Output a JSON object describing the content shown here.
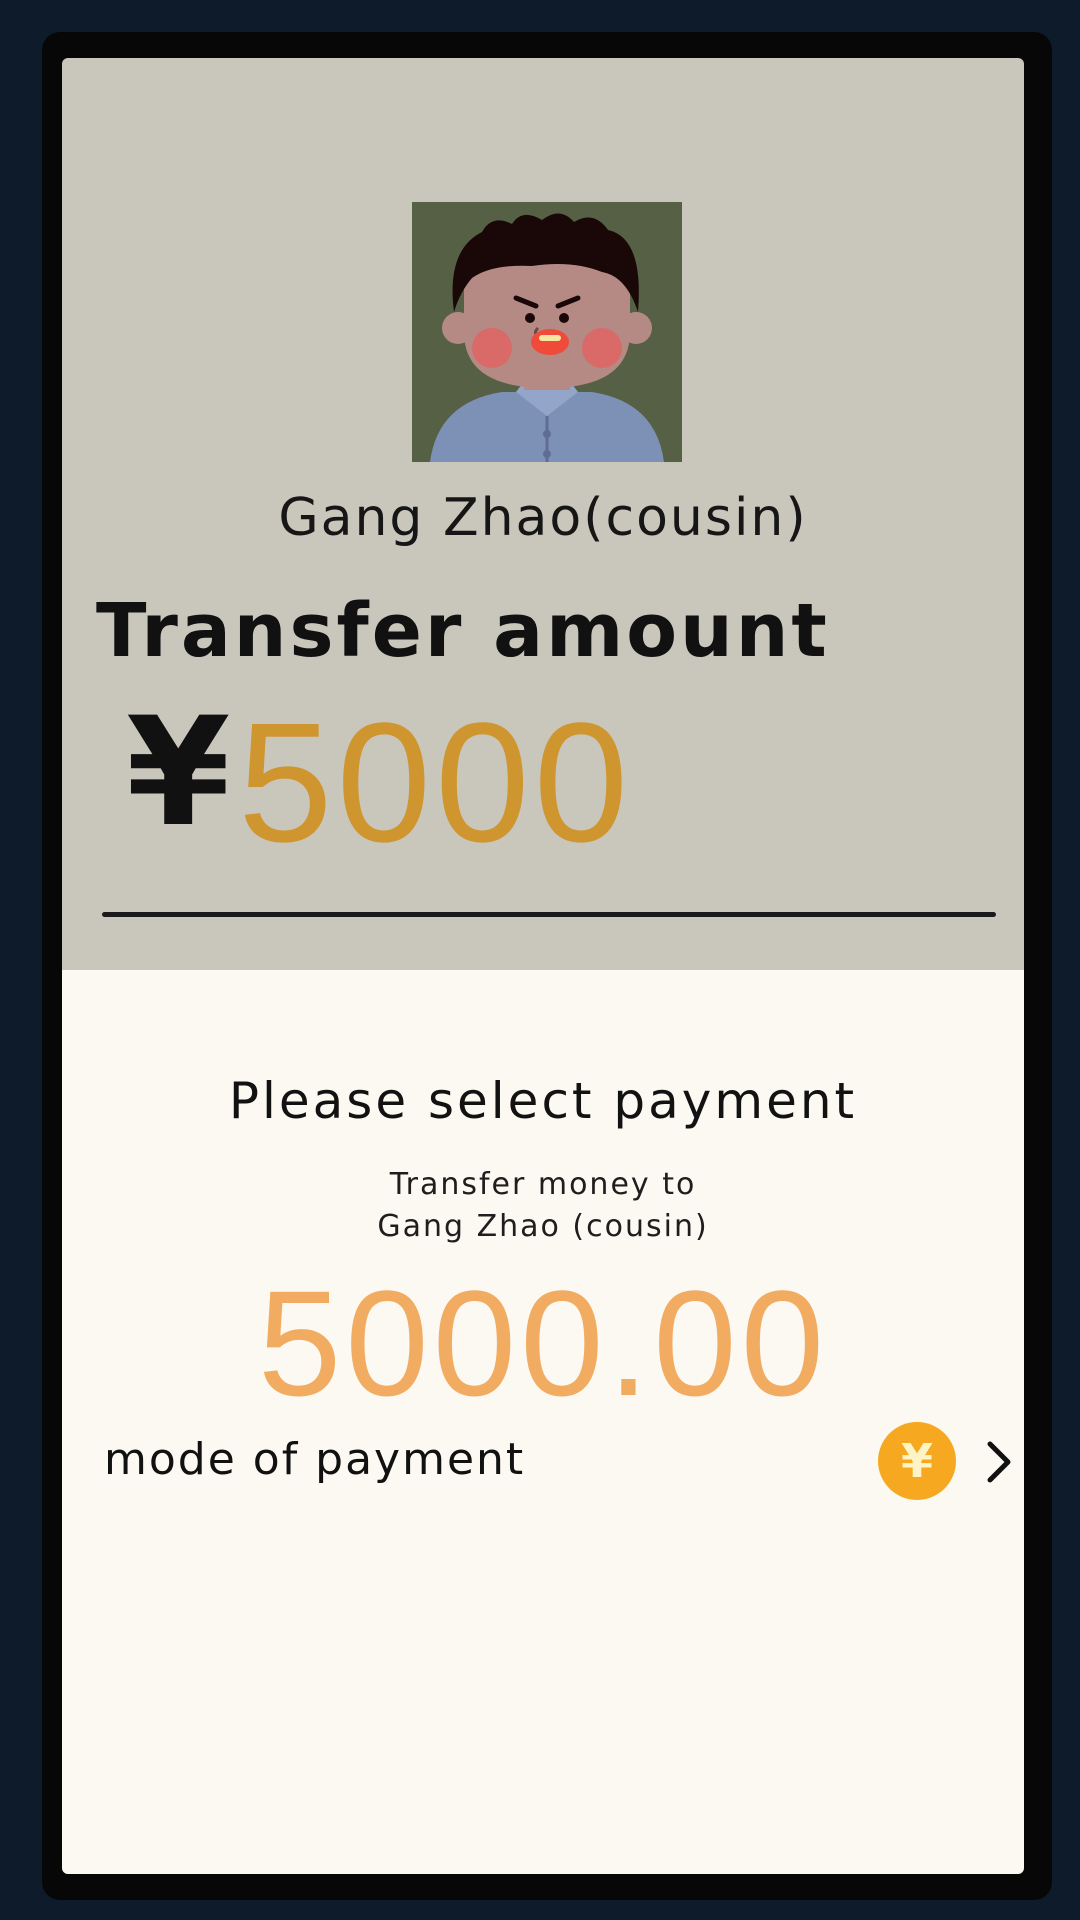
{
  "contact": {
    "name": "Gang Zhao(cousin)"
  },
  "transfer": {
    "label": "Transfer amount",
    "currency_symbol": "¥",
    "amount": "5000"
  },
  "payment_sheet": {
    "title": "Please select payment",
    "transfer_to_line1": "Transfer money to",
    "transfer_to_line2": "Gang Zhao (cousin)",
    "amount": "5000.00",
    "mode_label": "mode of payment",
    "mode_icon": "yuan-coin-icon",
    "coin_symbol": "¥"
  },
  "colors": {
    "amount_accent": "#cf952f",
    "sheet_amount": "#f2ac62",
    "coin": "#f6a920"
  }
}
